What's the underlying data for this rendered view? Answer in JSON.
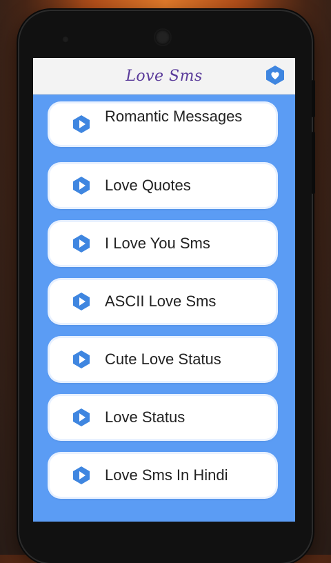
{
  "app": {
    "title": "Love Sms",
    "fav_icon": "heart-hexagon-icon",
    "accent": "#3f86e0",
    "background": "#5b9cf4"
  },
  "menu": {
    "items": [
      {
        "label": "Romantic Messages",
        "icon": "play-hexagon-icon"
      },
      {
        "label": "Love Quotes",
        "icon": "play-hexagon-icon"
      },
      {
        "label": "I Love You Sms",
        "icon": "play-hexagon-icon"
      },
      {
        "label": "ASCII Love Sms",
        "icon": "play-hexagon-icon"
      },
      {
        "label": "Cute Love Status",
        "icon": "play-hexagon-icon"
      },
      {
        "label": "Love Status",
        "icon": "play-hexagon-icon"
      },
      {
        "label": "Love Sms In Hindi",
        "icon": "play-hexagon-icon"
      }
    ]
  }
}
